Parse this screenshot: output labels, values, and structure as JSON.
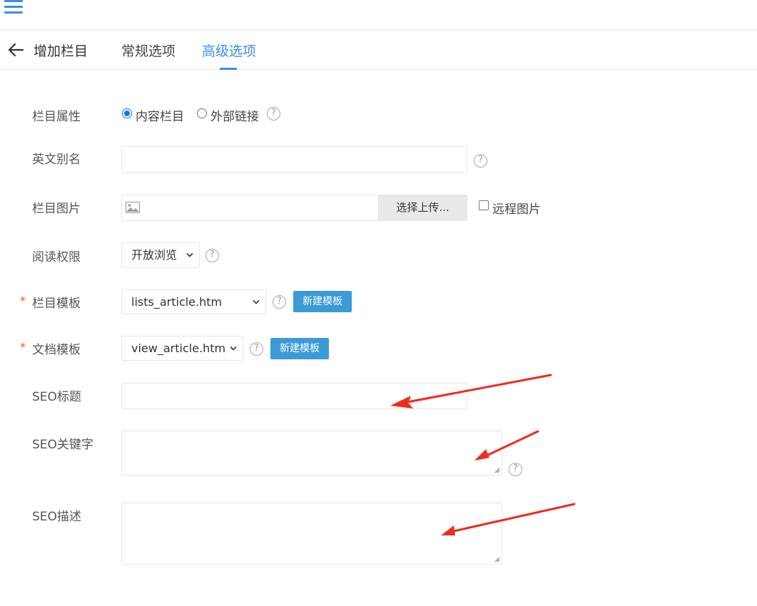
{
  "header": {
    "title": "增加栏目",
    "tabs": [
      {
        "label": "常规选项",
        "active": false
      },
      {
        "label": "高级选项",
        "active": true
      }
    ]
  },
  "form": {
    "attribute": {
      "label": "栏目属性",
      "options": [
        "内容栏目",
        "外部链接"
      ],
      "selected": "内容栏目"
    },
    "alias": {
      "label": "英文别名",
      "value": ""
    },
    "image": {
      "label": "栏目图片",
      "upload_label": "选择上传...",
      "remote_label": "远程图片",
      "remote_checked": false
    },
    "permission": {
      "label": "阅读权限",
      "value": "开放浏览"
    },
    "list_template": {
      "label": "栏目模板",
      "value": "lists_article.htm",
      "new_label": "新建模板",
      "required_mark": "*"
    },
    "doc_template": {
      "label": "文档模板",
      "value": "view_article.htm",
      "new_label": "新建模板",
      "required_mark": "*"
    },
    "seo_title": {
      "label": "SEO标题",
      "value": ""
    },
    "seo_keywords": {
      "label": "SEO关键字",
      "value": ""
    },
    "seo_description": {
      "label": "SEO描述",
      "value": ""
    }
  },
  "help_glyph": "?",
  "colors": {
    "accent": "#3a8ee6",
    "button": "#3a9bd5",
    "required": "#e8541e",
    "annotation_arrow": "#f02b1f"
  },
  "icons": {
    "menu": "menu-icon",
    "back": "back-arrow-icon",
    "image": "image-icon",
    "help": "help-icon",
    "chevron": "chevron-down-icon"
  }
}
